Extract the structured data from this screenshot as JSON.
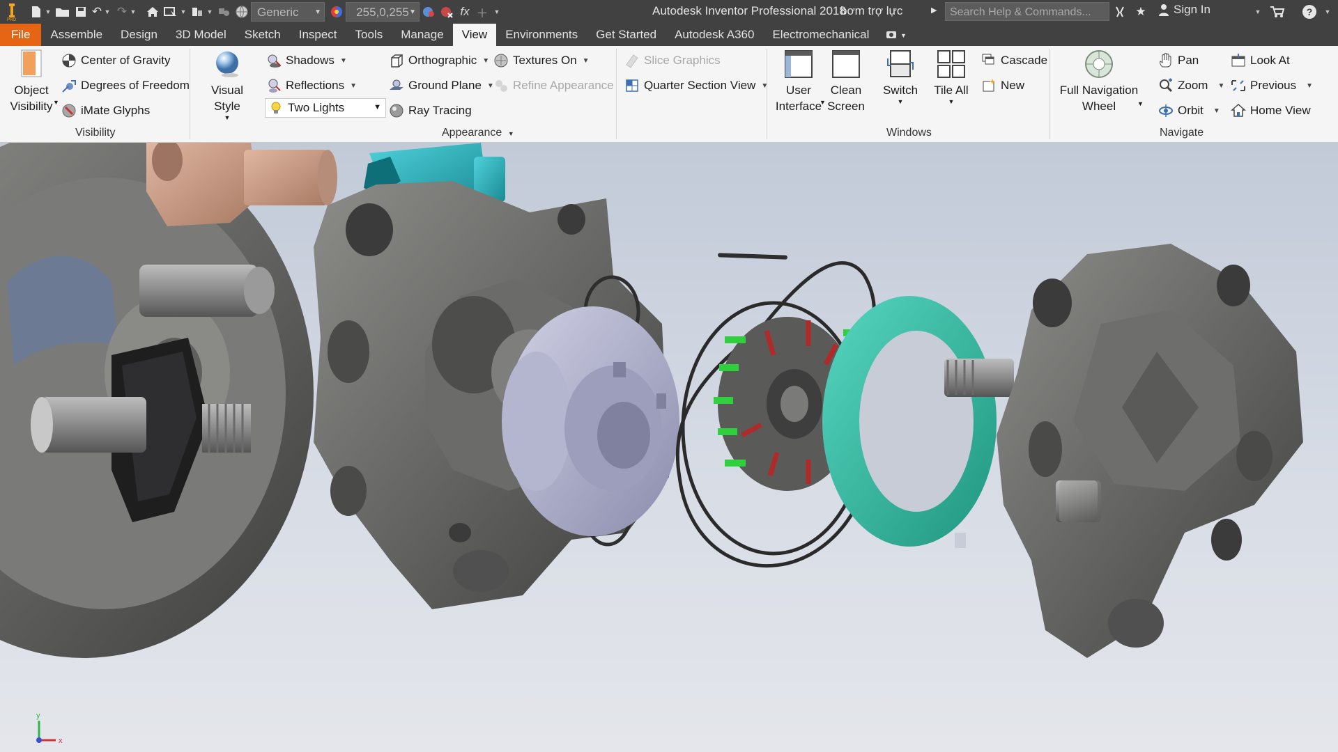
{
  "titlebar": {
    "app_title": "Autodesk Inventor Professional 2018",
    "doc_title": "bơm trợ lực",
    "material_combo": "Generic",
    "color_combo": "255,0,255",
    "search_placeholder": "Search Help & Commands...",
    "sign_in": "Sign In",
    "fx_symbol": "fx",
    "help_symbol": "?"
  },
  "tabs": [
    {
      "label": "File"
    },
    {
      "label": "Assemble"
    },
    {
      "label": "Design"
    },
    {
      "label": "3D Model"
    },
    {
      "label": "Sketch"
    },
    {
      "label": "Inspect"
    },
    {
      "label": "Tools"
    },
    {
      "label": "Manage"
    },
    {
      "label": "View"
    },
    {
      "label": "Environments"
    },
    {
      "label": "Get Started"
    },
    {
      "label": "Autodesk A360"
    },
    {
      "label": "Electromechanical"
    }
  ],
  "active_tab": "View",
  "ribbon": {
    "visibility": {
      "title": "Visibility",
      "object_visibility_1": "Object",
      "object_visibility_2": "Visibility",
      "center_of_gravity": "Center of Gravity",
      "degrees_of_freedom": "Degrees of Freedom",
      "imate_glyphs": "iMate Glyphs"
    },
    "appearance": {
      "title": "Appearance",
      "visual_style": "Visual Style",
      "shadows": "Shadows",
      "reflections": "Reflections",
      "lighting": "Two Lights",
      "orthographic": "Orthographic",
      "ground_plane": "Ground Plane",
      "ray_tracing": "Ray Tracing",
      "textures_on": "Textures On",
      "refine_appearance": "Refine Appearance",
      "slice_graphics": "Slice Graphics",
      "quarter_section_view": "Quarter Section View"
    },
    "windows": {
      "title": "Windows",
      "user_interface_1": "User",
      "user_interface_2": "Interface",
      "clean_screen_1": "Clean",
      "clean_screen_2": "Screen",
      "switch": "Switch",
      "tile_all": "Tile All",
      "cascade": "Cascade",
      "new": "New"
    },
    "navigate": {
      "title": "Navigate",
      "full_nav_wheel_1": "Full Navigation",
      "full_nav_wheel_2": "Wheel",
      "pan": "Pan",
      "zoom": "Zoom",
      "orbit": "Orbit",
      "look_at": "Look At",
      "previous": "Previous",
      "home_view": "Home View"
    }
  },
  "viewport": {
    "triad_x_label": "x",
    "triad_y_label": "y",
    "background": "#c9d0dc"
  },
  "colors": {
    "titlebar": "#414141",
    "file_tab": "#e56514",
    "ribbon": "#f5f5f5",
    "part_gray": "#6c6c6a",
    "part_cyan": "#25a6b0",
    "part_teal": "#33bda7",
    "part_copper": "#c99b84",
    "part_lavender": "#a6a8c4"
  }
}
